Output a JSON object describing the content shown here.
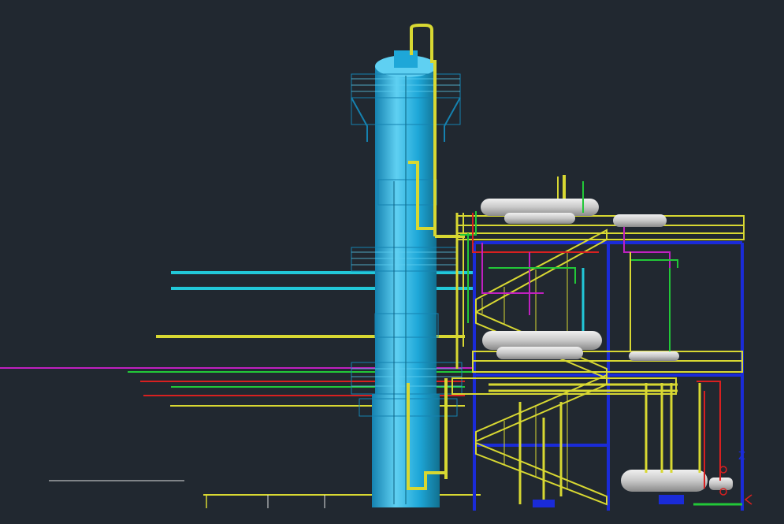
{
  "viewport": {
    "background": "#212830",
    "colors": {
      "column": "#1ea7d8",
      "column_dark": "#1582b0",
      "column_light": "#5fd0f2",
      "yellow_pipe": "#d8d832",
      "cyan_pipe": "#22c8d8",
      "magenta_pipe": "#c020c0",
      "green_pipe": "#22c838",
      "red_pipe": "#d82020",
      "blue_frame": "#1a2bd8",
      "vessel": "#c8c8c8",
      "grid_line": "#e0e0e0",
      "scale_bar": "#e0e0e0"
    },
    "ucs_icon": {
      "axis_z_label": "Z",
      "icon_name": "ucs-axis-icon"
    },
    "objects": [
      "distillation-column",
      "top-platforms",
      "structural-frame",
      "horizontal-vessels",
      "stairs",
      "pipe-rack",
      "pump-skid"
    ]
  }
}
